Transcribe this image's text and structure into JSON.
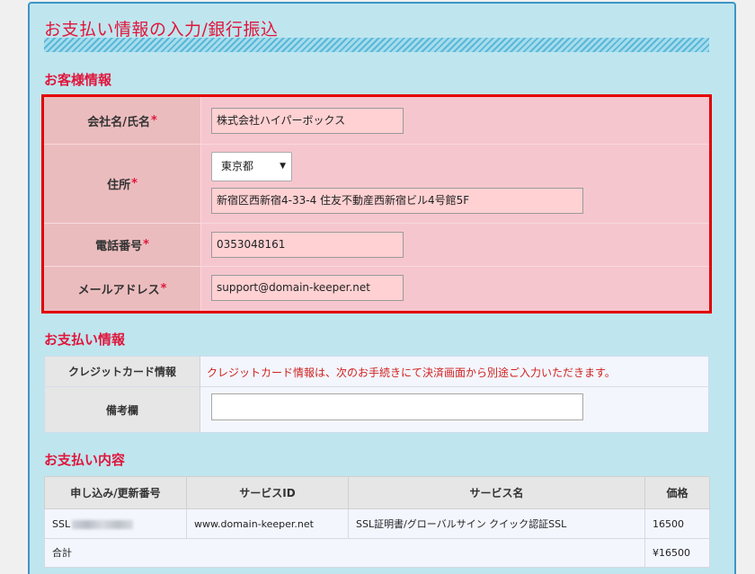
{
  "page_title": "お支払い情報の入力/銀行振込",
  "customer": {
    "section_title": "お客様情報",
    "required_mark": "*",
    "company_label": "会社名/氏名",
    "company_value": "株式会社ハイパーボックス",
    "address_label": "住所",
    "prefecture_value": "東京都",
    "address_value": "新宿区西新宿4-33-4 住友不動産西新宿ビル4号館5F",
    "phone_label": "電話番号",
    "phone_value": "0353048161",
    "email_label": "メールアドレス",
    "email_value": "support@domain-keeper.net"
  },
  "payment": {
    "section_title": "お支払い情報",
    "card_label": "クレジットカード情報",
    "card_note": "クレジットカード情報は、次のお手続きにて決済画面から別途ご入力いただきます。",
    "remarks_label": "備考欄",
    "remarks_value": ""
  },
  "order": {
    "section_title": "お支払い内容",
    "headers": [
      "申し込み/更新番号",
      "サービスID",
      "サービス名",
      "価格"
    ],
    "row": {
      "number_prefix": "SSL",
      "service_id": "www.domain-keeper.net",
      "service_name": "SSL証明書/グローバルサイン クイック認証SSL",
      "price": "16500"
    },
    "total_label": "合計",
    "total_value": "¥16500"
  },
  "colors": {
    "accent_red": "#e0163c",
    "panel_bg": "#bfe6ef",
    "required_border": "#e30000",
    "highlight_bg": "#f6c6ce"
  }
}
